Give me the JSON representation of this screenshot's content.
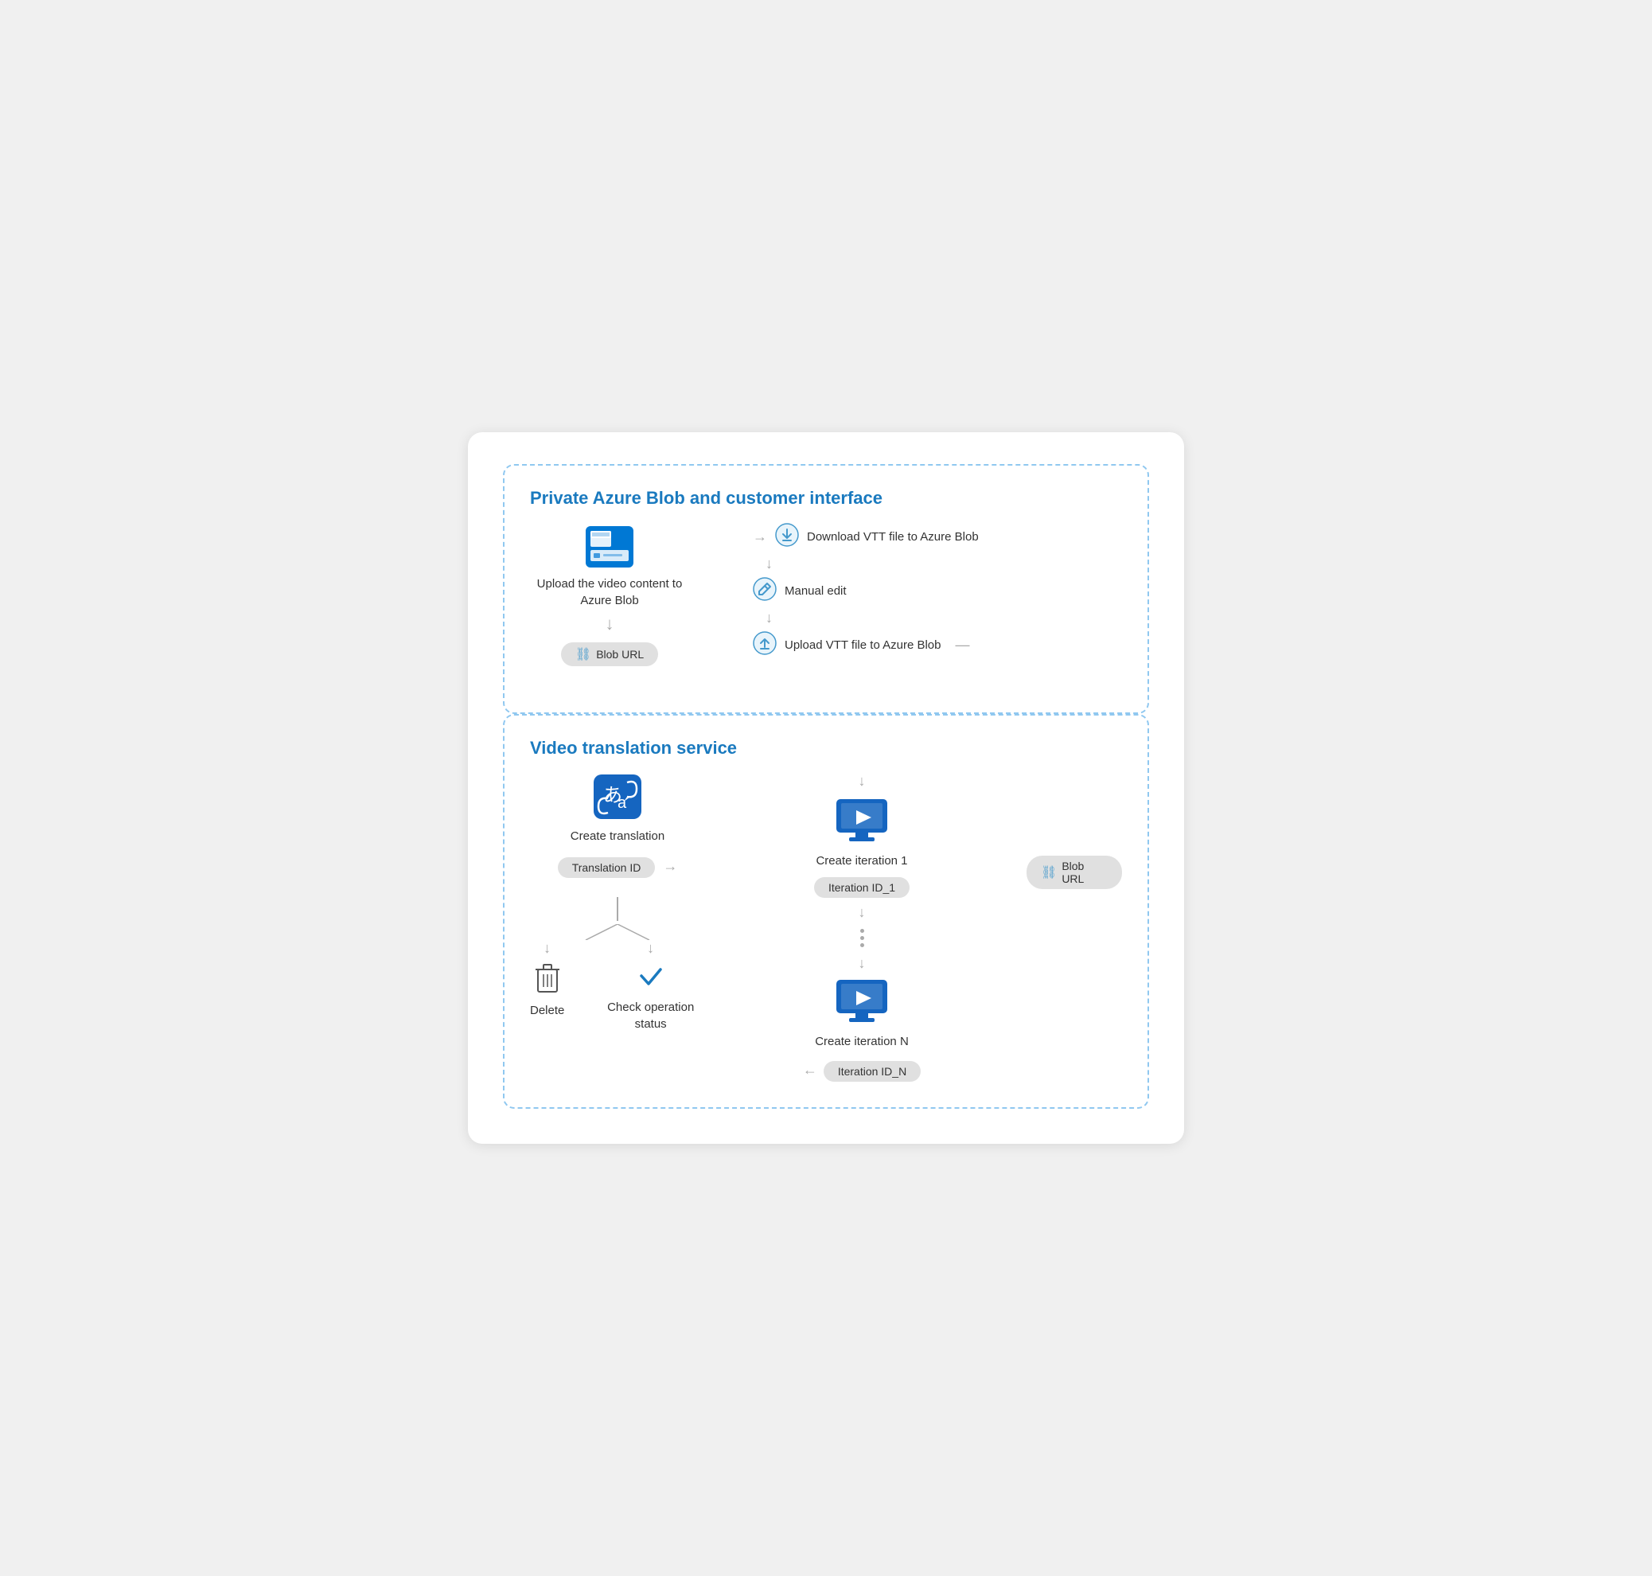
{
  "card": {
    "top_section": {
      "title": "Private Azure Blob and customer interface",
      "left": {
        "icon": "azure-blob-icon",
        "label": "Upload the video content to Azure Blob",
        "badge_icon": "link-icon",
        "badge_label": "Blob URL"
      },
      "right": {
        "steps": [
          {
            "icon": "download-icon",
            "label": "Download VTT file to Azure Blob"
          },
          {
            "icon": "edit-icon",
            "label": "Manual edit"
          },
          {
            "icon": "upload-icon",
            "label": "Upload VTT file to Azure Blob"
          }
        ]
      }
    },
    "bottom_section": {
      "title": "Video translation service",
      "left": {
        "icon": "translate-icon",
        "label": "Create translation",
        "translation_id_label": "Translation ID",
        "branches": [
          {
            "icon": "delete-icon",
            "label": "Delete"
          },
          {
            "icon": "check-icon",
            "label": "Check operation status"
          }
        ]
      },
      "middle": {
        "create_iteration_1_label": "Create iteration 1",
        "iteration_id_1_label": "Iteration ID_1",
        "create_iteration_n_label": "Create iteration N",
        "iteration_id_n_label": "Iteration ID_N"
      },
      "right": {
        "badge_icon": "link-icon",
        "badge_label": "Blob URL"
      }
    }
  }
}
